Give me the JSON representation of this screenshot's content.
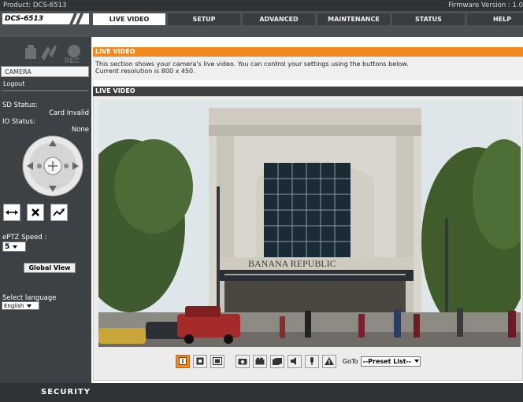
{
  "topbar": {
    "product": "Product: DCS-6513",
    "firmware": "Firmware Version : 1.0"
  },
  "header": {
    "model": "DCS-6513",
    "tabs": [
      {
        "label": "LIVE VIDEO",
        "active": true
      },
      {
        "label": "SETUP",
        "active": false
      },
      {
        "label": "ADVANCED",
        "active": false
      },
      {
        "label": "MAINTENANCE",
        "active": false
      },
      {
        "label": "STATUS",
        "active": false
      },
      {
        "label": "HELP",
        "active": false
      }
    ]
  },
  "sidebar": {
    "rec_label": "REC",
    "camera_button": "CAMERA",
    "logout": "Logout",
    "sd_status_label": "SD Status:",
    "sd_status_value": "Card Invalid",
    "io_status_label": "IO Status:",
    "io_status_value": "None",
    "eptz_speed_label": "ePTZ Speed :",
    "eptz_speed_value": "5",
    "global_view_button": "Global View",
    "select_language_label": "Select language",
    "language_value": "English"
  },
  "main": {
    "info_title": "LIVE VIDEO",
    "info_line1": "This section shows your camera's live video. You can control your settings using the buttons below.",
    "info_line2": "Current resolution is 800 x 450.",
    "live_video_title": "LIVE VIDEO",
    "storefront_sign": "BANANA REPUBLIC",
    "toolbar": {
      "goto_label": "GoTo",
      "preset_value": "--Preset List--"
    }
  },
  "footer": {
    "text": "SECURITY"
  },
  "colors": {
    "accent_orange": "#f08a1e",
    "topbar": "#2f3336",
    "header": "#4b5054",
    "sidebar": "#3c4145"
  }
}
